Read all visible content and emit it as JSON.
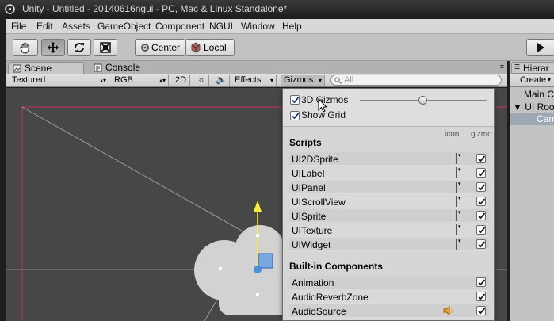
{
  "window": {
    "title": "Unity - Untitled - 20140616ngui - PC, Mac & Linux Standalone*"
  },
  "menu": [
    "File",
    "Edit",
    "Assets",
    "GameObject",
    "Component",
    "NGUI",
    "Window",
    "Help"
  ],
  "toolbar": {
    "pivot_label": "Center",
    "space_label": "Local"
  },
  "tabs": {
    "scene": "Scene",
    "console": "Console",
    "hierarchy": "Hierar"
  },
  "scene_toolbar": {
    "render_mode": "Textured",
    "color_mode": "RGB",
    "mode_2d": "2D",
    "effects": "Effects",
    "gizmos": "Gizmos",
    "search_placeholder": "All"
  },
  "hierarchy": {
    "create": "Create",
    "items": [
      "Main C",
      "UI Roo",
      "Cam"
    ]
  },
  "gizmos_popup": {
    "gizmos_3d": "3D Gizmos",
    "gizmos_3d_checked": true,
    "icon_size_fraction": 0.55,
    "show_grid": "Show Grid",
    "show_grid_checked": true,
    "col_icon": "icon",
    "col_gizmo": "gizmo",
    "scripts_header": "Scripts",
    "scripts": [
      "UI2DSprite",
      "UILabel",
      "UIPanel",
      "UIScrollView",
      "UISprite",
      "UITexture",
      "UIWidget"
    ],
    "builtin_header": "Built-in Components",
    "builtin": [
      "Animation",
      "AudioReverbZone",
      "AudioSource"
    ]
  },
  "colors": {
    "accent": "#c0306a",
    "handle_yellow": "#ffeb3b",
    "handle_blue": "#4a8fd8"
  }
}
